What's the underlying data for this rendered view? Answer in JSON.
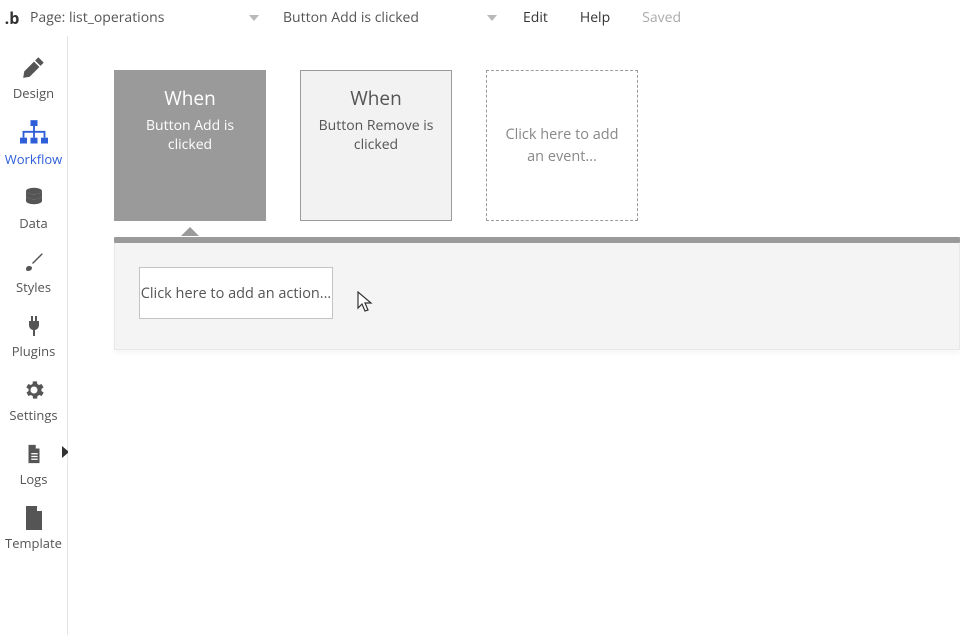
{
  "topbar": {
    "logo": ".b",
    "page_dropdown_label": "Page: list_operations",
    "event_dropdown_label": "Button Add is clicked",
    "edit": "Edit",
    "help": "Help",
    "saved": "Saved"
  },
  "sidebar": {
    "design": "Design",
    "workflow": "Workflow",
    "data": "Data",
    "styles": "Styles",
    "plugins": "Plugins",
    "settings": "Settings",
    "logs": "Logs",
    "template": "Template"
  },
  "events": {
    "when": "When",
    "card1_desc": "Button Add is clicked",
    "card2_desc": "Button Remove is clicked",
    "add_event": "Click here to add an event..."
  },
  "actions": {
    "add_action": "Click here to add an action..."
  }
}
